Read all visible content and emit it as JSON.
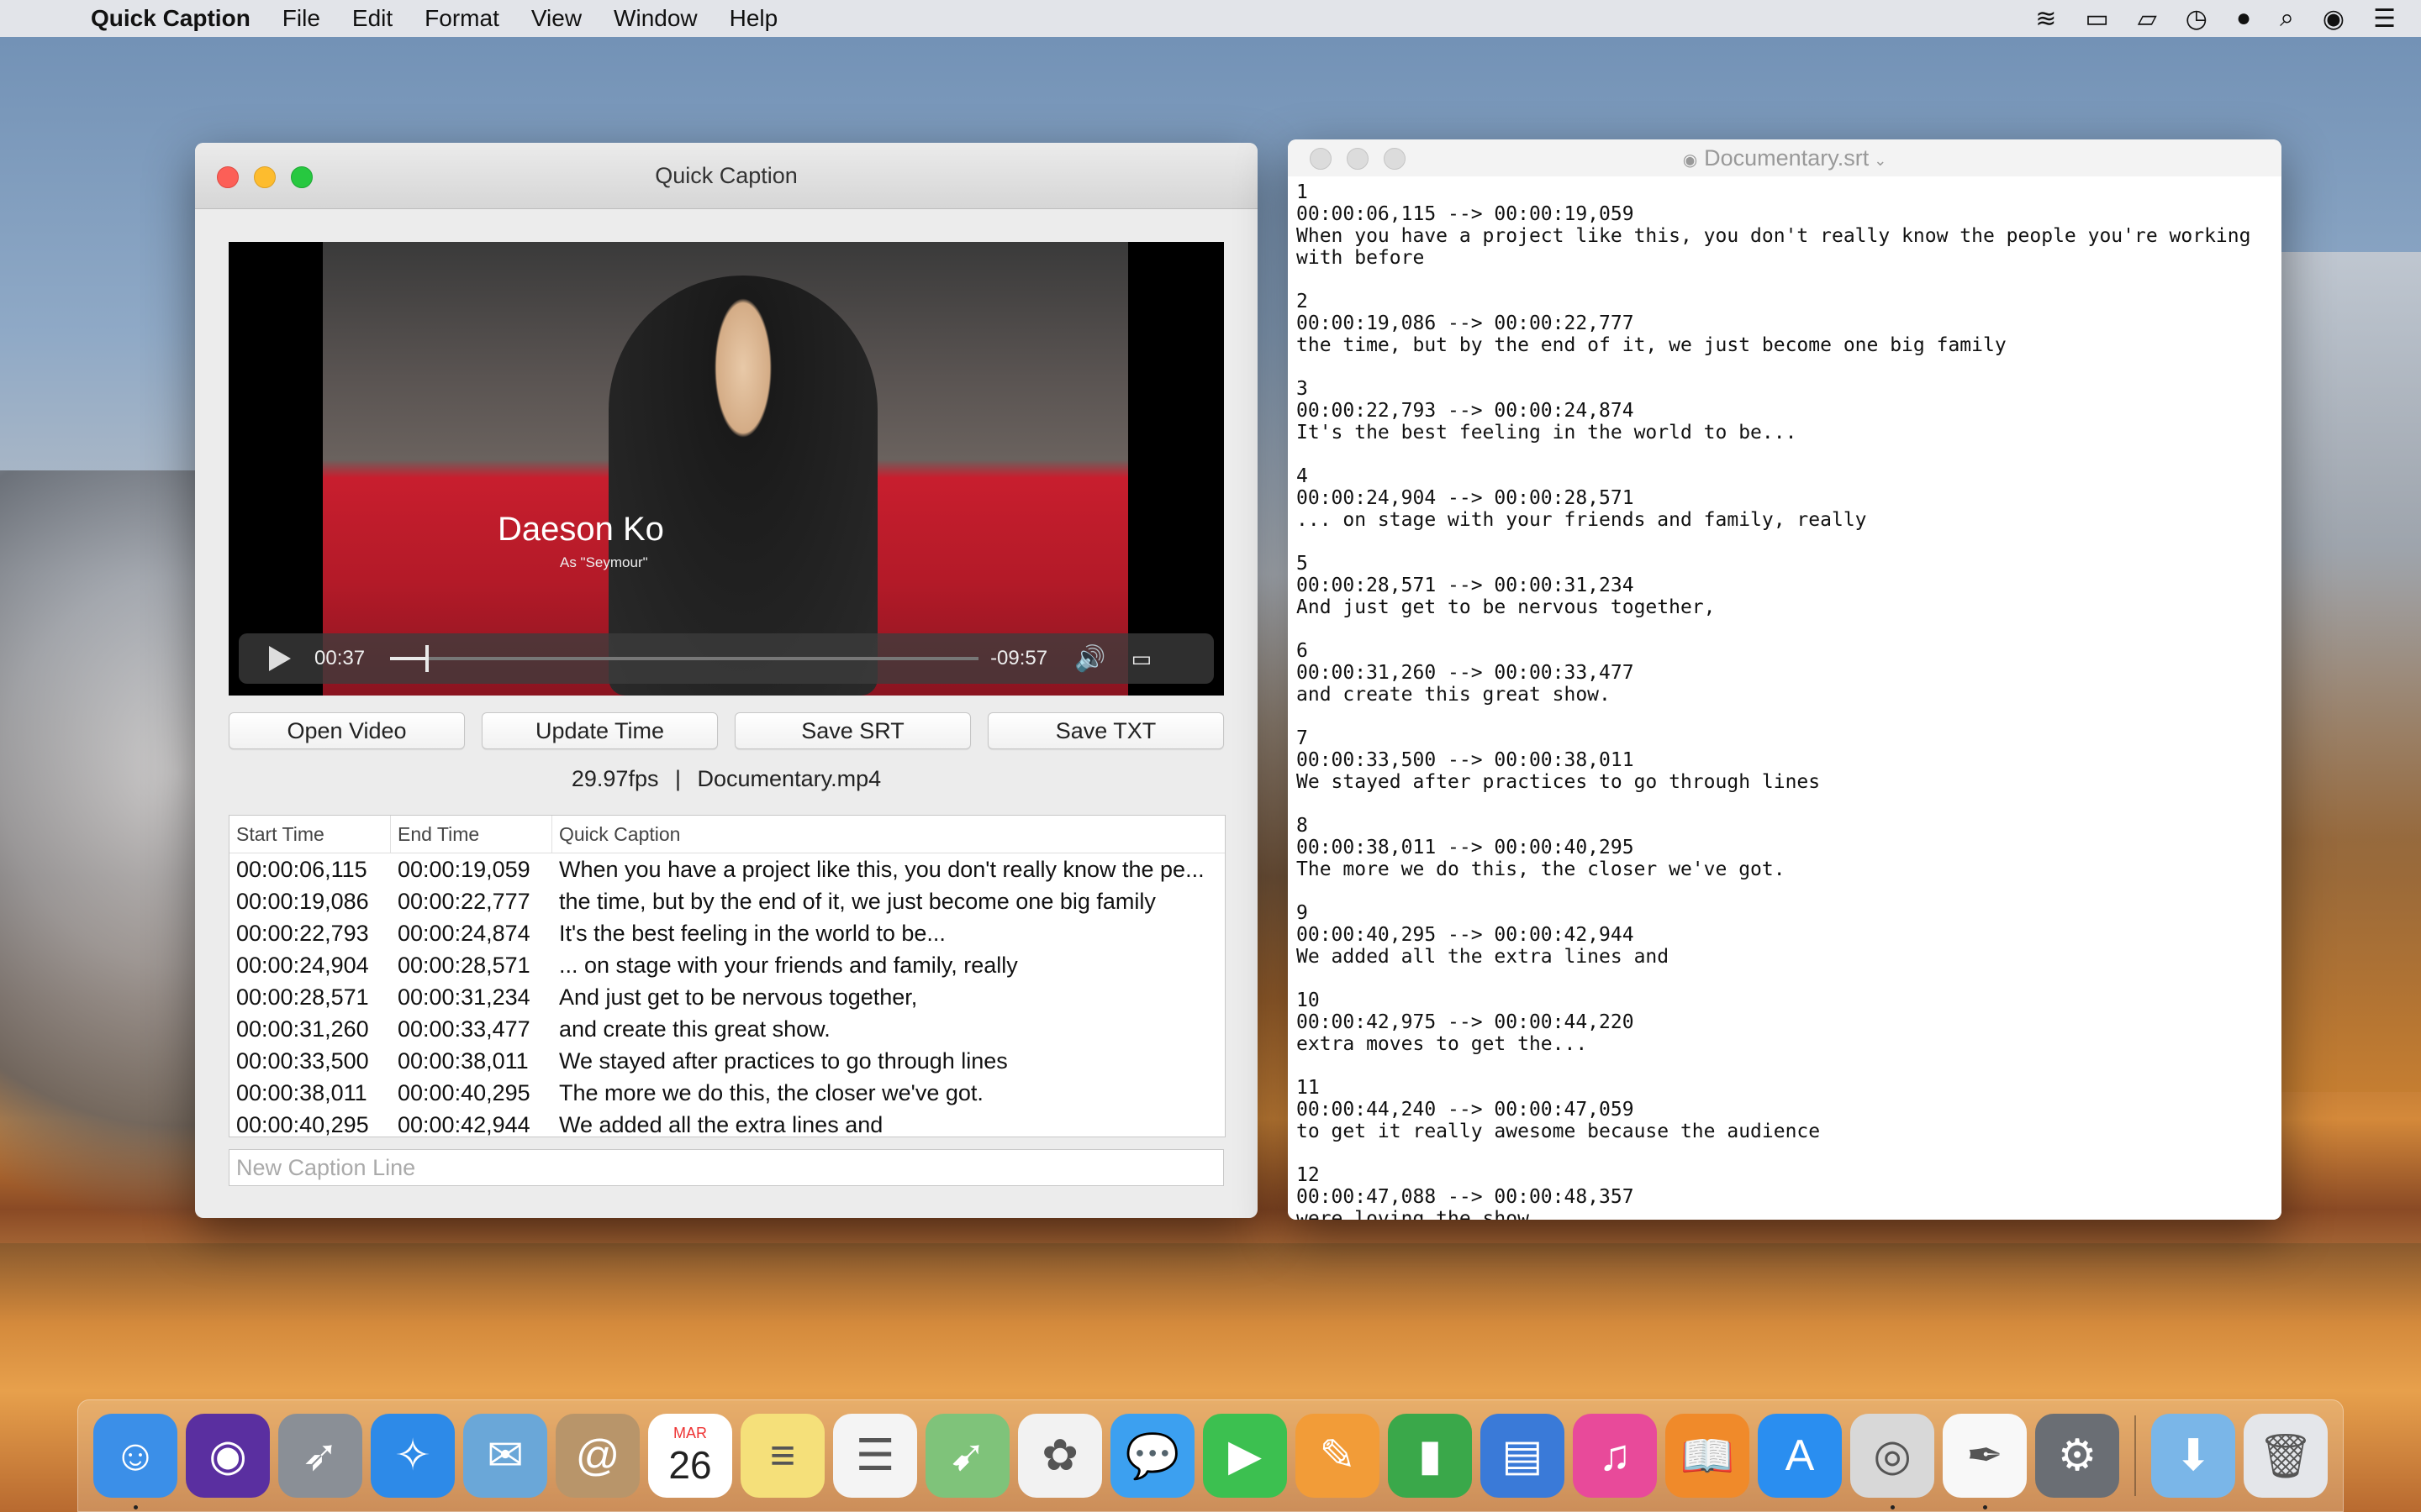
{
  "menubar": {
    "app_name": "Quick Caption",
    "items": [
      "File",
      "Edit",
      "Format",
      "View",
      "Window",
      "Help"
    ],
    "status_icons": [
      "wifi-icon",
      "battery-icon",
      "airplay-icon",
      "time-machine-icon",
      "user-icon",
      "spotlight-icon",
      "siri-icon",
      "notification-center-icon"
    ]
  },
  "main_window": {
    "title": "Quick Caption",
    "video": {
      "overlay_name": "Daeson Ko",
      "overlay_sub": "As \"Seymour\"",
      "current_time": "00:37",
      "remaining_time": "-09:57",
      "progress": 0.06
    },
    "buttons": {
      "open_video": "Open Video",
      "update_time": "Update Time",
      "save_srt": "Save SRT",
      "save_txt": "Save TXT"
    },
    "fps_info": "29.97fps",
    "separator": "|",
    "file_name": "Documentary.mp4",
    "table": {
      "headers": [
        "Start Time",
        "End Time",
        "Quick Caption"
      ],
      "rows": [
        [
          "00:00:06,115",
          "00:00:19,059",
          "When you have a project like this, you don't really know the pe..."
        ],
        [
          "00:00:19,086",
          "00:00:22,777",
          "the time, but by the end of it, we just become one big family"
        ],
        [
          "00:00:22,793",
          "00:00:24,874",
          "It's the best feeling in the world to be..."
        ],
        [
          "00:00:24,904",
          "00:00:28,571",
          "... on stage with your friends and family, really"
        ],
        [
          "00:00:28,571",
          "00:00:31,234",
          "And just get to be nervous together,"
        ],
        [
          "00:00:31,260",
          "00:00:33,477",
          "and create this great show."
        ],
        [
          "00:00:33,500",
          "00:00:38,011",
          "We stayed after practices to go through lines"
        ],
        [
          "00:00:38,011",
          "00:00:40,295",
          "The more we do this, the closer we've got."
        ],
        [
          "00:00:40,295",
          "00:00:42,944",
          "We added all the extra lines and"
        ]
      ]
    },
    "new_caption_placeholder": "New Caption Line"
  },
  "editor_window": {
    "title": "Documentary.srt",
    "entries": [
      {
        "n": "1",
        "time": "00:00:06,115 --> 00:00:19,059",
        "text": "When you have a project like this, you don't really know the people you're working\nwith before"
      },
      {
        "n": "2",
        "time": "00:00:19,086 --> 00:00:22,777",
        "text": "the time, but by the end of it, we just become one big family"
      },
      {
        "n": "3",
        "time": "00:00:22,793 --> 00:00:24,874",
        "text": "It's the best feeling in the world to be..."
      },
      {
        "n": "4",
        "time": "00:00:24,904 --> 00:00:28,571",
        "text": "... on stage with your friends and family, really"
      },
      {
        "n": "5",
        "time": "00:00:28,571 --> 00:00:31,234",
        "text": "And just get to be nervous together,"
      },
      {
        "n": "6",
        "time": "00:00:31,260 --> 00:00:33,477",
        "text": "and create this great show."
      },
      {
        "n": "7",
        "time": "00:00:33,500 --> 00:00:38,011",
        "text": "We stayed after practices to go through lines"
      },
      {
        "n": "8",
        "time": "00:00:38,011 --> 00:00:40,295",
        "text": "The more we do this, the closer we've got."
      },
      {
        "n": "9",
        "time": "00:00:40,295 --> 00:00:42,944",
        "text": "We added all the extra lines and"
      },
      {
        "n": "10",
        "time": "00:00:42,975 --> 00:00:44,220",
        "text": "extra moves to get the..."
      },
      {
        "n": "11",
        "time": "00:00:44,240 --> 00:00:47,059",
        "text": "to get it really awesome because the audience"
      },
      {
        "n": "12",
        "time": "00:00:47,088 --> 00:00:48,357",
        "text": "were loving the show."
      }
    ]
  },
  "dock": {
    "calendar_month": "MAR",
    "calendar_day": "26",
    "apps": [
      {
        "name": "finder-icon",
        "color": "#3b8fe8",
        "glyph": "☺",
        "running": true
      },
      {
        "name": "siri-icon",
        "color": "#5a2fa0",
        "glyph": "◉",
        "running": false
      },
      {
        "name": "launchpad-icon",
        "color": "#8a8f96",
        "glyph": "➶",
        "running": false
      },
      {
        "name": "safari-icon",
        "color": "#2d8ae8",
        "glyph": "✧",
        "running": false
      },
      {
        "name": "mail-icon",
        "color": "#6aa7d8",
        "glyph": "✉",
        "running": false
      },
      {
        "name": "contacts-icon",
        "color": "#b8956a",
        "glyph": "@",
        "running": false
      },
      {
        "name": "calendar-icon",
        "color": "#ffffff",
        "glyph": "",
        "running": false
      },
      {
        "name": "notes-icon",
        "color": "#f5e07a",
        "glyph": "≡",
        "running": false
      },
      {
        "name": "reminders-icon",
        "color": "#f4f4f4",
        "glyph": "☰",
        "running": false
      },
      {
        "name": "maps-icon",
        "color": "#7fc37a",
        "glyph": "➹",
        "running": false
      },
      {
        "name": "photos-icon",
        "color": "#f2f2f2",
        "glyph": "✿",
        "running": false
      },
      {
        "name": "messages-icon",
        "color": "#3ca0f0",
        "glyph": "💬",
        "running": false
      },
      {
        "name": "facetime-icon",
        "color": "#3cc050",
        "glyph": "▶",
        "running": false
      },
      {
        "name": "pages-icon",
        "color": "#f29c38",
        "glyph": "✎",
        "running": false
      },
      {
        "name": "numbers-icon",
        "color": "#3aa84a",
        "glyph": "▮",
        "running": false
      },
      {
        "name": "keynote-icon",
        "color": "#3a7ad8",
        "glyph": "▤",
        "running": false
      },
      {
        "name": "itunes-icon",
        "color": "#e84a9a",
        "glyph": "♫",
        "running": false
      },
      {
        "name": "ibooks-icon",
        "color": "#f08a2a",
        "glyph": "📖",
        "running": false
      },
      {
        "name": "app-store-icon",
        "color": "#2a8ef0",
        "glyph": "A",
        "running": false
      },
      {
        "name": "quick-caption-icon",
        "color": "#d8d8d8",
        "glyph": "◎",
        "running": true
      },
      {
        "name": "textedit-icon",
        "color": "#f8f8f8",
        "glyph": "✒",
        "running": true
      },
      {
        "name": "system-preferences-icon",
        "color": "#6a6e74",
        "glyph": "⚙",
        "running": false
      }
    ],
    "right": [
      {
        "name": "downloads-folder-icon",
        "color": "#7ab6e8",
        "glyph": "⬇"
      },
      {
        "name": "trash-icon",
        "color": "#e4e6ea",
        "glyph": "🗑"
      }
    ]
  }
}
